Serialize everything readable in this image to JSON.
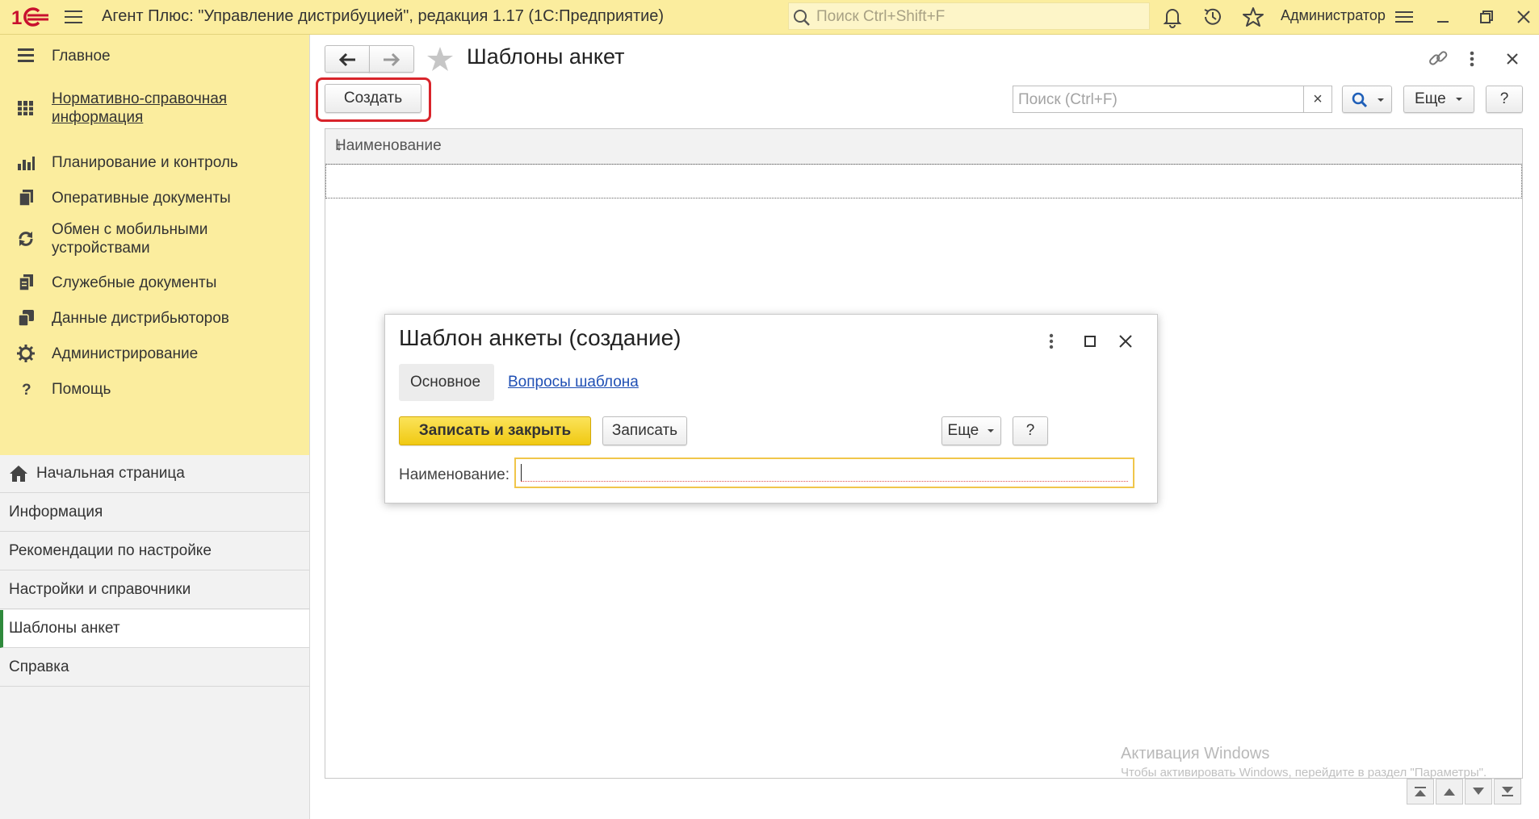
{
  "app": {
    "title": "Агент Плюс: \"Управление дистрибуцией\", редакция 1.17  (1С:Предприятие)",
    "search_placeholder": "Поиск Ctrl+Shift+F",
    "user": "Администратор"
  },
  "colors": {
    "topbar": "#fbed9e",
    "accent_yellow": "#f5d21b",
    "active_marker": "#2f8a3c",
    "highlight_ring": "#d9242b",
    "link": "#1f4fb4"
  },
  "sections": [
    {
      "icon": "menu-lines-icon",
      "label": "Главное"
    },
    {
      "icon": "grid-book-icon",
      "label": "Нормативно-справочная информация",
      "lines": [
        "Нормативно-справочная",
        "информация"
      ]
    },
    {
      "icon": "bar-chart-icon",
      "label": "Планирование и контроль"
    },
    {
      "icon": "documents-icon",
      "label": "Оперативные документы"
    },
    {
      "icon": "sync-icon",
      "label": "Обмен с мобильными устройствами",
      "lines": [
        "Обмен с мобильными",
        "устройствами"
      ]
    },
    {
      "icon": "service-docs-icon",
      "label": "Служебные документы"
    },
    {
      "icon": "distributor-data-icon",
      "label": "Данные дистрибьюторов"
    },
    {
      "icon": "gear-icon",
      "label": "Администрирование"
    },
    {
      "icon": "question-icon",
      "label": "Помощь"
    }
  ],
  "nav": [
    {
      "label": "Начальная страница",
      "icon": "home-icon"
    },
    {
      "label": "Информация"
    },
    {
      "label": "Рекомендации по настройке"
    },
    {
      "label": "Настройки и справочники"
    },
    {
      "label": "Шаблоны анкет",
      "active": true
    },
    {
      "label": "Справка"
    }
  ],
  "main": {
    "title": "Шаблоны анкет",
    "create_label": "Создать",
    "search_placeholder": "Поиск (Ctrl+F)",
    "clear_label": "×",
    "more_label": "Еще",
    "help_label": "?",
    "columns": [
      "Наименование"
    ],
    "sort_indicator": "↓"
  },
  "dialog": {
    "title": "Шаблон анкеты (создание)",
    "tabs": [
      "Основное",
      "Вопросы шаблона"
    ],
    "save_close_label": "Записать и закрыть",
    "save_label": "Записать",
    "more_label": "Еще",
    "help_label": "?",
    "field_label": "Наименование:",
    "field_value": ""
  },
  "watermark": {
    "line1": "Активация Windows",
    "line2": "Чтобы активировать Windows, перейдите в раздел \"Параметры\"."
  }
}
